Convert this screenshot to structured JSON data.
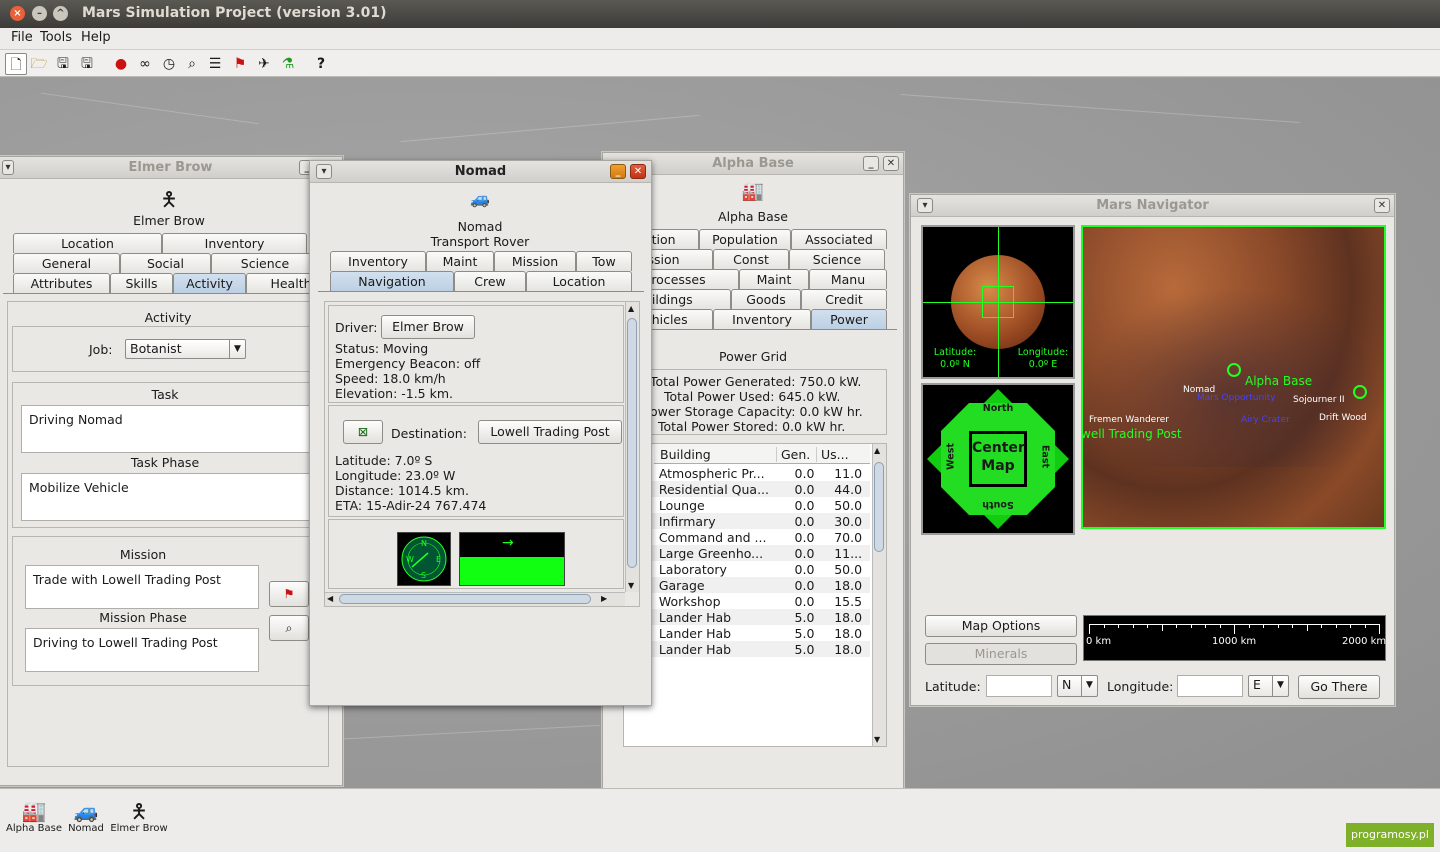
{
  "app": {
    "title": "Mars Simulation Project (version 3.01)"
  },
  "menu": {
    "file": "File",
    "tools": "Tools",
    "help": "Help"
  },
  "toolbar": {
    "icons": [
      "new-icon",
      "open-icon",
      "save-icon",
      "save-as-icon",
      "mars-icon",
      "binoculars-icon",
      "clock-icon",
      "search-icon",
      "list-icon",
      "flag-icon",
      "navigator-icon",
      "flask-icon",
      "help-icon"
    ]
  },
  "elmer": {
    "title": "Elmer Brow",
    "name": "Elmer Brow",
    "tabs_row1": [
      "Location",
      "Inventory"
    ],
    "tabs_row2": [
      "General",
      "Social",
      "Science"
    ],
    "tabs_row3": [
      "Attributes",
      "Skills",
      "Activity",
      "Health"
    ],
    "activity_label": "Activity",
    "job_label": "Job:",
    "job_value": "Botanist",
    "task_label": "Task",
    "task_value": "Driving Nomad",
    "task_phase_label": "Task Phase",
    "task_phase_value": "Mobilize Vehicle",
    "mission_label": "Mission",
    "mission_value": "Trade with Lowell Trading Post",
    "mission_phase_label": "Mission Phase",
    "mission_phase_value": "Driving to Lowell Trading Post"
  },
  "nomad": {
    "title": "Nomad",
    "name": "Nomad",
    "type": "Transport Rover",
    "tabs_row1": [
      "Inventory",
      "Maint",
      "Mission",
      "Tow"
    ],
    "tabs_row2": [
      "Navigation",
      "Crew",
      "Location"
    ],
    "driver_label": "Driver:",
    "driver_value": "Elmer Brow",
    "status": "Status: Moving",
    "beacon": "Emergency Beacon: off",
    "speed": "Speed: 18.0 km/h",
    "elevation": "Elevation: -1.5 km.",
    "destination_label": "Destination:",
    "destination_value": "Lowell Trading Post",
    "latitude": "Latitude: 7.0º S",
    "longitude": "Longitude: 23.0º W",
    "distance": "Distance: 1014.5 km.",
    "eta": "ETA: 15-Adir-24  767.474",
    "compass": {
      "n": "N",
      "e": "E",
      "s": "S",
      "w": "W"
    }
  },
  "alpha": {
    "title": "Alpha Base",
    "name": "Alpha Base",
    "tabs_row1": [
      "ation",
      "Population",
      "Associated"
    ],
    "tabs_row2": [
      "ission",
      "Const",
      "Science"
    ],
    "tabs_row3": [
      "Processes",
      "Maint",
      "Manu"
    ],
    "tabs_row4": [
      "uildings",
      "Goods",
      "Credit"
    ],
    "tabs_row5": [
      "ehicles",
      "Inventory",
      "Power"
    ],
    "power_grid_label": "Power Grid",
    "generated": "Total Power Generated: 750.0 kW.",
    "used": "Total Power Used: 645.0 kW.",
    "storage": "ower Storage Capacity: 0.0 kW hr.",
    "stored": "Total Power Stored: 0.0 kW hr.",
    "columns": [
      "Building",
      "Gen.",
      "Us..."
    ],
    "rows": [
      {
        "name": "Atmospheric Pr...",
        "gen": "0.0",
        "use": "11.0"
      },
      {
        "name": "Residential Qua...",
        "gen": "0.0",
        "use": "44.0"
      },
      {
        "name": "Lounge",
        "gen": "0.0",
        "use": "50.0"
      },
      {
        "name": "Infirmary",
        "gen": "0.0",
        "use": "30.0"
      },
      {
        "name": "Command and ...",
        "gen": "0.0",
        "use": "70.0"
      },
      {
        "name": "Large Greenho...",
        "gen": "0.0",
        "use": "11..."
      },
      {
        "name": "Laboratory",
        "gen": "0.0",
        "use": "50.0"
      },
      {
        "name": "Garage",
        "gen": "0.0",
        "use": "18.0"
      },
      {
        "name": "Workshop",
        "gen": "0.0",
        "use": "15.5"
      },
      {
        "name": "Lander Hab",
        "gen": "5.0",
        "use": "18.0"
      },
      {
        "name": "Lander Hab",
        "gen": "5.0",
        "use": "18.0"
      },
      {
        "name": "Lander Hab",
        "gen": "5.0",
        "use": "18.0"
      }
    ],
    "active_row_indices": [
      9,
      10,
      11
    ]
  },
  "navigator": {
    "title": "Mars Navigator",
    "globe_lat_label": "Latitude:",
    "globe_lat_value": "0.0º N",
    "globe_lon_label": "Longitude:",
    "globe_lon_value": "0.0º E",
    "north": "North",
    "south": "South",
    "east": "East",
    "west": "West",
    "center": "Center",
    "center2": "Map",
    "map_labels": [
      "Alpha Base",
      "Nomad",
      "Mars Opportunity",
      "Sojourner II",
      "Fremen Wanderer",
      "Airy Crater",
      "Drift Wood",
      "well Trading Post"
    ],
    "map_options": "Map Options",
    "minerals": "Minerals",
    "scale": [
      "0 km",
      "1000 km",
      "2000 km"
    ],
    "latitude_label": "Latitude:",
    "lat_dir": "N",
    "longitude_label": "Longitude:",
    "lon_dir": "E",
    "go_there": "Go There",
    "colors": {
      "green": "#33ff33",
      "mars": "#8b4a2a"
    }
  },
  "taskbar": {
    "items": [
      {
        "label": "Alpha Base",
        "icon": "settlement-icon"
      },
      {
        "label": "Nomad",
        "icon": "rover-icon"
      },
      {
        "label": "Elmer Brow",
        "icon": "person-icon"
      }
    ],
    "watermark": "programosy.pl"
  }
}
